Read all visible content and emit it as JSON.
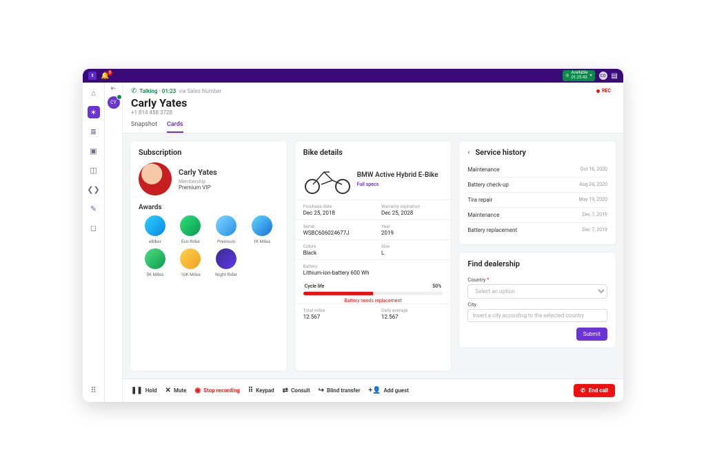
{
  "topbar": {
    "notif_count": "8",
    "status_label": "Available",
    "status_time": "01:25:43",
    "user_initials": "CO"
  },
  "header": {
    "call_state": "Talking",
    "call_timer": "01:23",
    "via": "via Sales Number",
    "rec": "REC",
    "name": "Carly Yates",
    "phone": "+1 814 458 3728"
  },
  "tabs": {
    "snapshot": "Snapshot",
    "cards": "Cards"
  },
  "subscription": {
    "title": "Subscription",
    "name": "Carly Yates",
    "membership_label": "Membership",
    "membership_tier": "Premium VIP",
    "awards_title": "Awards",
    "awards": [
      "eBiker",
      "Eco Rider",
      "Premium",
      "1K Miles",
      "5K Miles",
      "10K Miles",
      "Night Rider"
    ]
  },
  "bike": {
    "title": "Bike details",
    "name": "BMW Active Hybrid E-Bike",
    "specs_link": "Full specs",
    "purchase_k": "Purchase date",
    "purchase_v": "Dec 25, 2018",
    "warranty_k": "Warranty expiration",
    "warranty_v": "Dec 25, 2028",
    "serial_k": "Serial",
    "serial_v": "WSBC606024677J",
    "year_k": "Year",
    "year_v": "2019",
    "colors_k": "Colors",
    "colors_v": "Black",
    "size_k": "Size",
    "size_v": "L",
    "battery_k": "Battery",
    "battery_v": "Lithium-ion-battery 600 Wh",
    "cycle_k": "Cycle life",
    "cycle_v": "50%",
    "cycle_pct": 50,
    "warn": "Battery needs replacement",
    "miles_k": "Total miles",
    "miles_v": "12.567",
    "avg_k": "Daily average",
    "avg_v": "12.567"
  },
  "service": {
    "title": "Service history",
    "rows": [
      {
        "n": "Maintenance",
        "d": "Oct 16, 2020"
      },
      {
        "n": "Battery check-up",
        "d": "Aug 24, 2020"
      },
      {
        "n": "Tira repair",
        "d": "May 19, 2020"
      },
      {
        "n": "Maintenance",
        "d": "Dec 7, 2019"
      },
      {
        "n": "Battery replacement",
        "d": "Dec 7, 2019"
      }
    ]
  },
  "dealer": {
    "title": "Find dealership",
    "country_label": "Country",
    "country_placeholder": "Select an option",
    "city_label": "City",
    "city_placeholder": "Insert a city according to the selected country",
    "submit": "Submit"
  },
  "callbar": {
    "hold": "Hold",
    "mute": "Mute",
    "stoprec": "Stop recording",
    "keypad": "Keypad",
    "consult": "Consult",
    "blind": "Blind transfer",
    "addguest": "Add guest",
    "end": "End call"
  }
}
